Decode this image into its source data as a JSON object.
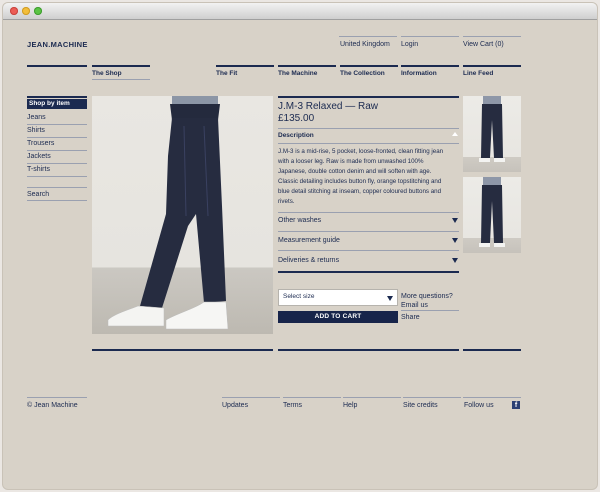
{
  "header": {
    "logo": "JEAN.MACHINE",
    "region": "United Kingdom",
    "login": "Login",
    "view_cart": "View Cart (0)"
  },
  "nav": {
    "items": [
      {
        "label": "The Shop"
      },
      {
        "label": "The Fit"
      },
      {
        "label": "The Machine"
      },
      {
        "label": "The Collection"
      },
      {
        "label": "Information"
      },
      {
        "label": "Line Feed"
      }
    ]
  },
  "sidebar": {
    "heading": "Shop by item",
    "items": [
      {
        "label": "Jeans"
      },
      {
        "label": "Shirts"
      },
      {
        "label": "Trousers"
      },
      {
        "label": "Jackets"
      },
      {
        "label": "T-shirts"
      }
    ],
    "search": "Search"
  },
  "product": {
    "title": "J.M-3 Relaxed — Raw",
    "price": "£135.00",
    "description_heading": "Description",
    "description_lines": [
      "J.M-3 is a mid-rise, 5 pocket, loose-fronted, clean fitting jean",
      "with a looser leg. Raw is made from unwashed 100%",
      "Japanese, double cotton denim and will soften with age.",
      "Classic detailing includes button fly, orange topstitching and",
      "blue detail stitching at inseam, copper coloured buttons and",
      "rivets."
    ],
    "accordions": [
      {
        "label": "Other washes"
      },
      {
        "label": "Measurement guide"
      },
      {
        "label": "Deliveries & returns"
      }
    ],
    "select_size": "Select size",
    "add_to_cart": "ADD TO CART",
    "more_questions": "More questions?",
    "email_us": "Email us",
    "share": "Share"
  },
  "footer": {
    "copyright": "© Jean Machine",
    "links": [
      {
        "label": "Updates"
      },
      {
        "label": "Terms"
      },
      {
        "label": "Help"
      },
      {
        "label": "Site credits"
      },
      {
        "label": "Follow us"
      }
    ]
  },
  "colors": {
    "page_background": "#d8d2c8",
    "ink_navy": "#1b2a50",
    "button_navy": "#17244a"
  },
  "icons": {
    "accordion_toggle": "triangle-down-icon",
    "description_toggle": "triangle-up-icon",
    "select_arrow": "triangle-down-icon",
    "social": "facebook-icon"
  }
}
